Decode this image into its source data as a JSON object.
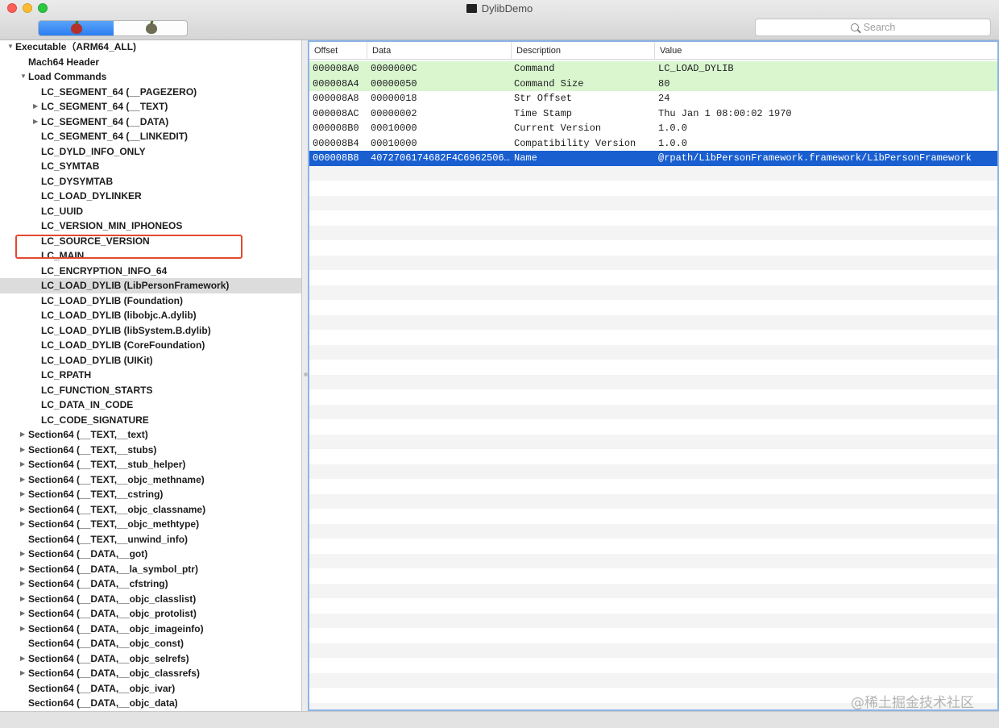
{
  "window": {
    "title": "DylibDemo"
  },
  "toolbar": {
    "segments": [
      "red-apple-icon",
      "gray-apple-icon"
    ],
    "search_placeholder": "Search"
  },
  "outline": {
    "rows": [
      {
        "label": "Executable（ARM64_ALL)",
        "tri": "▼"
      },
      {
        "label": "Mach64 Header",
        "tri": ""
      },
      {
        "label": "Load Commands",
        "tri": "▼"
      },
      {
        "label": "LC_SEGMENT_64 (__PAGEZERO)",
        "tri": ""
      },
      {
        "label": "LC_SEGMENT_64 (__TEXT)",
        "tri": "▶"
      },
      {
        "label": "LC_SEGMENT_64 (__DATA)",
        "tri": "▶"
      },
      {
        "label": "LC_SEGMENT_64 (__LINKEDIT)",
        "tri": ""
      },
      {
        "label": "LC_DYLD_INFO_ONLY",
        "tri": ""
      },
      {
        "label": "LC_SYMTAB",
        "tri": ""
      },
      {
        "label": "LC_DYSYMTAB",
        "tri": ""
      },
      {
        "label": "LC_LOAD_DYLINKER",
        "tri": ""
      },
      {
        "label": "LC_UUID",
        "tri": ""
      },
      {
        "label": "LC_VERSION_MIN_IPHONEOS",
        "tri": ""
      },
      {
        "label": "LC_SOURCE_VERSION",
        "tri": ""
      },
      {
        "label": "LC_MAIN",
        "tri": ""
      },
      {
        "label": "LC_ENCRYPTION_INFO_64",
        "tri": ""
      },
      {
        "label": "LC_LOAD_DYLIB (LibPersonFramework)",
        "tri": ""
      },
      {
        "label": "LC_LOAD_DYLIB (Foundation)",
        "tri": ""
      },
      {
        "label": "LC_LOAD_DYLIB (libobjc.A.dylib)",
        "tri": ""
      },
      {
        "label": "LC_LOAD_DYLIB (libSystem.B.dylib)",
        "tri": ""
      },
      {
        "label": "LC_LOAD_DYLIB (CoreFoundation)",
        "tri": ""
      },
      {
        "label": "LC_LOAD_DYLIB (UIKit)",
        "tri": ""
      },
      {
        "label": "LC_RPATH",
        "tri": ""
      },
      {
        "label": "LC_FUNCTION_STARTS",
        "tri": ""
      },
      {
        "label": "LC_DATA_IN_CODE",
        "tri": ""
      },
      {
        "label": "LC_CODE_SIGNATURE",
        "tri": ""
      },
      {
        "label": "Section64 (__TEXT,__text)",
        "tri": "▶"
      },
      {
        "label": "Section64 (__TEXT,__stubs)",
        "tri": "▶"
      },
      {
        "label": "Section64 (__TEXT,__stub_helper)",
        "tri": "▶"
      },
      {
        "label": "Section64 (__TEXT,__objc_methname)",
        "tri": "▶"
      },
      {
        "label": "Section64 (__TEXT,__cstring)",
        "tri": "▶"
      },
      {
        "label": "Section64 (__TEXT,__objc_classname)",
        "tri": "▶"
      },
      {
        "label": "Section64 (__TEXT,__objc_methtype)",
        "tri": "▶"
      },
      {
        "label": "Section64 (__TEXT,__unwind_info)",
        "tri": ""
      },
      {
        "label": "Section64 (__DATA,__got)",
        "tri": "▶"
      },
      {
        "label": "Section64 (__DATA,__la_symbol_ptr)",
        "tri": "▶"
      },
      {
        "label": "Section64 (__DATA,__cfstring)",
        "tri": "▶"
      },
      {
        "label": "Section64 (__DATA,__objc_classlist)",
        "tri": "▶"
      },
      {
        "label": "Section64 (__DATA,__objc_protolist)",
        "tri": "▶"
      },
      {
        "label": "Section64 (__DATA,__objc_imageinfo)",
        "tri": "▶"
      },
      {
        "label": "Section64 (__DATA,__objc_const)",
        "tri": ""
      },
      {
        "label": "Section64 (__DATA,__objc_selrefs)",
        "tri": "▶"
      },
      {
        "label": "Section64 (__DATA,__objc_classrefs)",
        "tri": "▶"
      },
      {
        "label": "Section64 (__DATA,__objc_ivar)",
        "tri": ""
      },
      {
        "label": "Section64 (__DATA,__objc_data)",
        "tri": ""
      }
    ],
    "selected_index": 16
  },
  "table": {
    "headers": [
      "Offset",
      "Data",
      "Description",
      "Value"
    ],
    "rows": [
      {
        "offset": "000008A0",
        "data": "0000000C",
        "description": "Command",
        "value": "LC_LOAD_DYLIB",
        "state": "green"
      },
      {
        "offset": "000008A4",
        "data": "00000050",
        "description": "Command Size",
        "value": "80",
        "state": "green"
      },
      {
        "offset": "000008A8",
        "data": "00000018",
        "description": "Str Offset",
        "value": "24",
        "state": ""
      },
      {
        "offset": "000008AC",
        "data": "00000002",
        "description": "Time Stamp",
        "value": "Thu Jan  1 08:00:02 1970",
        "state": ""
      },
      {
        "offset": "000008B0",
        "data": "00010000",
        "description": "Current Version",
        "value": "1.0.0",
        "state": ""
      },
      {
        "offset": "000008B4",
        "data": "00010000",
        "description": "Compatibility Version",
        "value": "1.0.0",
        "state": ""
      },
      {
        "offset": "000008B8",
        "data": "4072706174682F4C6962506…",
        "description": "Name",
        "value": "@rpath/LibPersonFramework.framework/LibPersonFramework",
        "state": "selected"
      }
    ]
  },
  "watermark": "@稀土掘金技术社区",
  "colors": {
    "highlight_box": "#e2492f",
    "selection_blue": "#1a5fd0",
    "green_row": "#d9f6cf"
  }
}
